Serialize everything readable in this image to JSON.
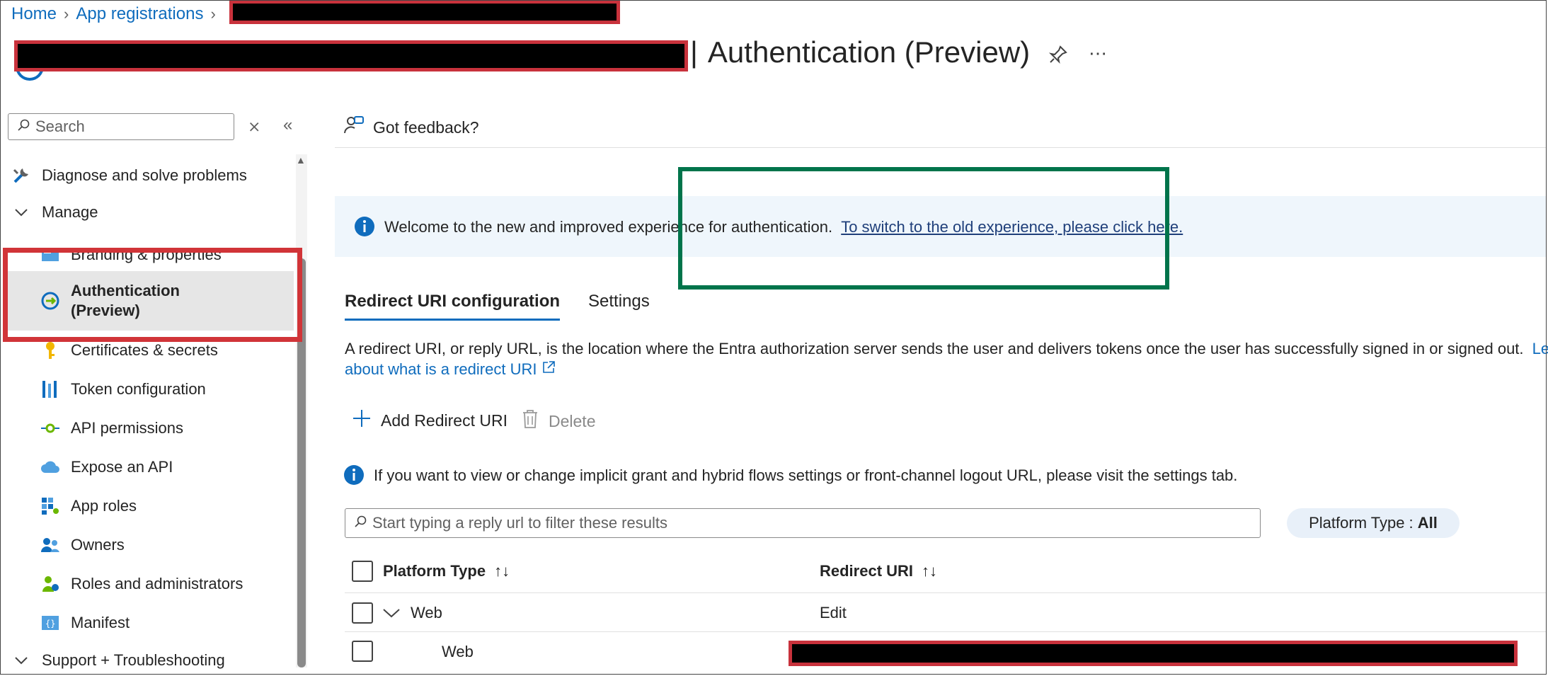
{
  "breadcrumb": {
    "home": "Home",
    "app_registrations": "App registrations"
  },
  "page": {
    "title_suffix": "Authentication (Preview)",
    "title_separator": "|"
  },
  "nav": {
    "search_placeholder": "Search",
    "items": [
      {
        "label": "Diagnose and solve problems",
        "icon": "wrench-icon"
      },
      {
        "label": "Manage",
        "icon": "chevron-down-icon"
      },
      {
        "label": "Branding & properties",
        "icon": "branding-icon"
      },
      {
        "label": "Authentication",
        "label2": "(Preview)",
        "icon": "authentication-icon"
      },
      {
        "label": "Certificates & secrets",
        "icon": "key-icon"
      },
      {
        "label": "Token configuration",
        "icon": "token-icon"
      },
      {
        "label": "API permissions",
        "icon": "api-permissions-icon"
      },
      {
        "label": "Expose an API",
        "icon": "cloud-icon"
      },
      {
        "label": "App roles",
        "icon": "app-roles-icon"
      },
      {
        "label": "Owners",
        "icon": "owners-icon"
      },
      {
        "label": "Roles and administrators",
        "icon": "roles-icon"
      },
      {
        "label": "Manifest",
        "icon": "manifest-icon"
      },
      {
        "label": "Support + Troubleshooting",
        "icon": "chevron-down-icon"
      }
    ]
  },
  "toolbar": {
    "feedback": "Got feedback?"
  },
  "banner": {
    "text": "Welcome to the new and improved experience for authentication.",
    "link": "To switch to the old experience, please click here."
  },
  "tabs": {
    "active": "Redirect URI configuration",
    "other": "Settings"
  },
  "description": {
    "line1": "A redirect URI, or reply URL, is the location where the Entra authorization server sends the user and delivers tokens once the user has successfully signed in or signed out.",
    "link_part1": "Le",
    "link_part2": "about what is a redirect URI"
  },
  "commands": {
    "add": "Add Redirect URI",
    "delete": "Delete"
  },
  "info": {
    "text": "If you want to view or change implicit grant and hybrid flows settings or front-channel logout URL, please visit the settings tab."
  },
  "filter": {
    "placeholder": "Start typing a reply url to filter these results"
  },
  "platform_pill": {
    "label": "Platform Type : ",
    "value": "All"
  },
  "table": {
    "headers": {
      "platform": "Platform Type",
      "redirect": "Redirect URI"
    },
    "rows": [
      {
        "platform": "Web",
        "redirect": "Edit"
      },
      {
        "platform": "Web",
        "redirect": ""
      }
    ]
  },
  "colors": {
    "accent": "#0f6cbd",
    "green_highlight": "#00744b",
    "red_highlight": "#d13438"
  }
}
